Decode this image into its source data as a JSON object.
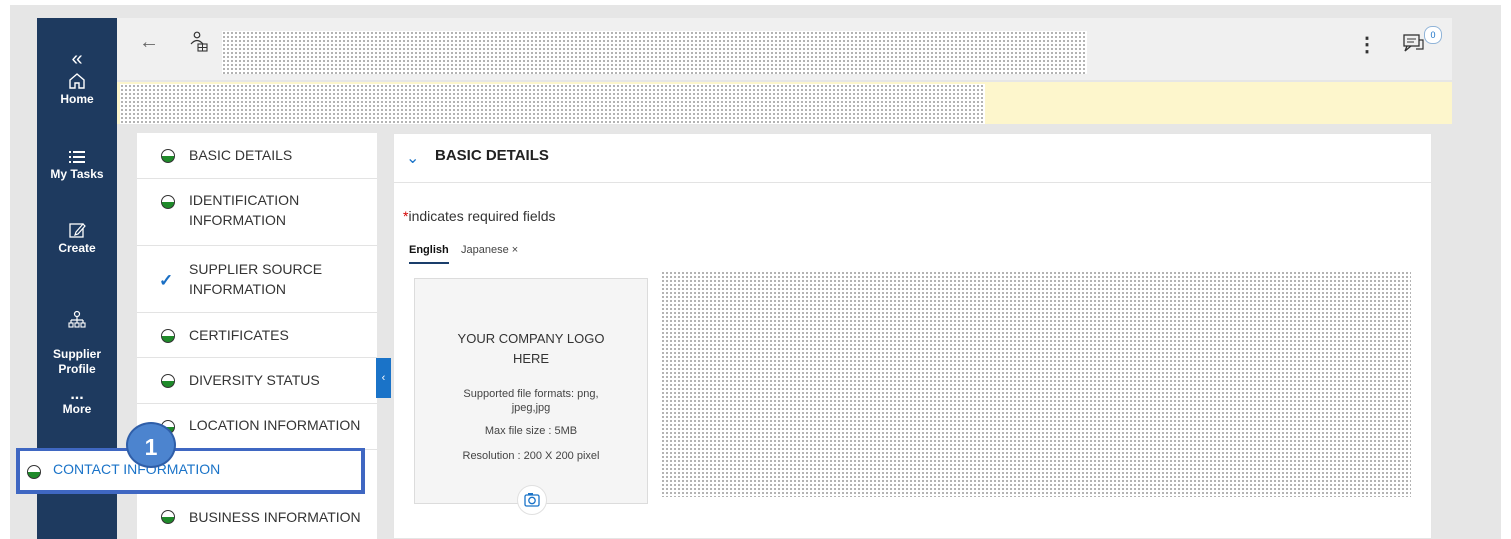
{
  "nav": {
    "collapse_glyph": "«",
    "items": [
      {
        "label": "Home",
        "icon": "home-icon"
      },
      {
        "label": "My Tasks",
        "icon": "list-icon"
      },
      {
        "label": "Create",
        "icon": "edit-icon"
      },
      {
        "label": "Supplier\nProfile",
        "icon": "org-chart-icon"
      },
      {
        "label": "More",
        "icon": "more-icon",
        "glyph": "..."
      }
    ]
  },
  "topbar": {
    "back_glyph": "←",
    "kebab_glyph": "⋮",
    "notification_count": "0"
  },
  "sections": [
    {
      "label": "BASIC DETAILS",
      "status": "partial"
    },
    {
      "label": "IDENTIFICATION\nINFORMATION",
      "status": "partial"
    },
    {
      "label": "SUPPLIER SOURCE\nINFORMATION",
      "status": "complete"
    },
    {
      "label": "CERTIFICATES",
      "status": "partial"
    },
    {
      "label": "DIVERSITY STATUS",
      "status": "partial"
    },
    {
      "label": "LOCATION INFORMATION",
      "status": "partial"
    },
    {
      "label": "CONTACT INFORMATION",
      "status": "partial"
    },
    {
      "label": "BUSINESS INFORMATION",
      "status": "partial"
    }
  ],
  "step_marker": "1",
  "panel": {
    "title": "BASIC DETAILS",
    "required_star": "*",
    "required_note": "indicates required fields",
    "tabs": [
      {
        "label": "English",
        "active": true
      },
      {
        "label": "Japanese ×",
        "active": false
      }
    ],
    "logo": {
      "title": "YOUR COMPANY LOGO\nHERE",
      "formats": "Supported file formats: png,\njpeg,jpg",
      "max_size": "Max file size : 5MB",
      "resolution": "Resolution : 200 X 200 pixel"
    }
  },
  "colors": {
    "nav_bg": "#1e3a5f",
    "accent": "#1a73c8",
    "banner": "#fdf6cc",
    "highlight_border": "#3f67c2",
    "status_green": "#1f8a2a"
  }
}
